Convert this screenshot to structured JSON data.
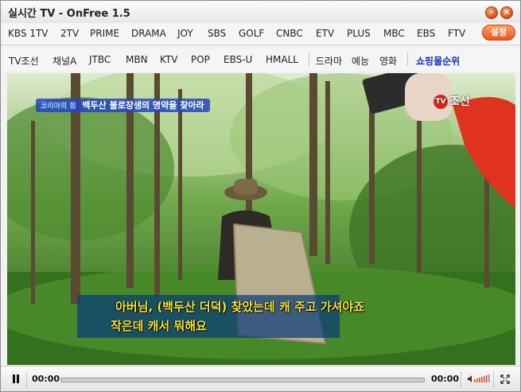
{
  "window": {
    "title": "실시간 TV - OnFree 1.5",
    "minimize_label": "–",
    "close_label": "×"
  },
  "channels_row1": [
    "KBS 1TV",
    "2TV",
    "PRIME",
    "DRAMA",
    "JOY",
    "SBS",
    "GOLF",
    "CNBC",
    "ETV",
    "PLUS",
    "MBC",
    "EBS",
    "FTV"
  ],
  "settings_label": "설정",
  "channels_row2": [
    "TV조선",
    "채널A",
    "JTBC",
    "MBN",
    "KTV",
    "POP",
    "EBS-U",
    "HMALL"
  ],
  "genre_row2": [
    "드라마",
    "예능",
    "영화"
  ],
  "shopping_rank_label": "쇼핑몰순위",
  "video": {
    "banner_brand": "코리아의 힘",
    "banner_text": "백두산 불로장생의 명약을 찾아라",
    "channel_logo": "조선",
    "logo_badge": "TV",
    "subtitle_line1": "아버님, (백두산 더덕) 찾았는데 캐 주고 가셔야죠",
    "subtitle_line2": "작은데 캐서 뭐해요"
  },
  "player": {
    "current_time": "00:00",
    "total_time": "00:00",
    "progress": 0
  },
  "colors": {
    "accent_orange": "#e8561d",
    "shopping_blue": "#1232b8",
    "subtitle_yellow": "#f6e640"
  }
}
